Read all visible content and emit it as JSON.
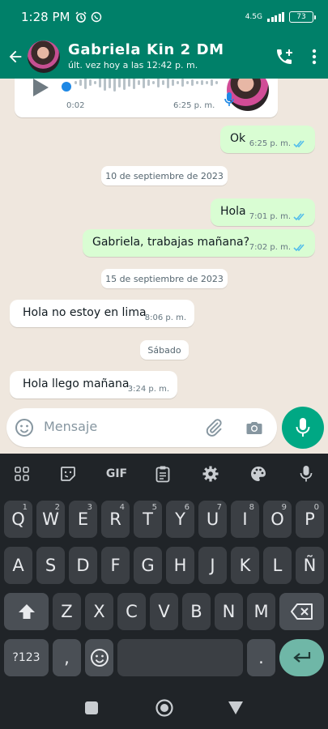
{
  "status_bar": {
    "time": "1:28 PM",
    "network": "4.5G",
    "battery": "73"
  },
  "header": {
    "contact_name": "Gabriela Kin 2 DM",
    "last_seen": "últ. vez hoy a las 12:42 p. m."
  },
  "voice_note": {
    "duration": "0:02",
    "time": "6:25 p. m."
  },
  "messages": [
    {
      "type": "out",
      "text": "Ok",
      "time": "6:25 p. m."
    },
    {
      "type": "date",
      "text": "10 de septiembre de 2023"
    },
    {
      "type": "out",
      "text": "Hola",
      "time": "7:01 p. m."
    },
    {
      "type": "out",
      "text": "Gabriela, trabajas mañana?",
      "time": "7:02 p. m."
    },
    {
      "type": "date",
      "text": "15 de septiembre de 2023"
    },
    {
      "type": "in",
      "text": "Hola no estoy en lima",
      "time": "8:06 p. m."
    },
    {
      "type": "date",
      "text": "Sábado"
    },
    {
      "type": "in",
      "text": "Hola llego mañana",
      "time": "3:24 p. m."
    }
  ],
  "composer": {
    "placeholder": "Mensaje"
  },
  "keyboard": {
    "toolbar_gif": "GIF",
    "row1": [
      "Q",
      "W",
      "E",
      "R",
      "T",
      "Y",
      "U",
      "I",
      "O",
      "P"
    ],
    "row1_hints": [
      "1",
      "2",
      "3",
      "4",
      "5",
      "6",
      "7",
      "8",
      "9",
      "0"
    ],
    "row2": [
      "A",
      "S",
      "D",
      "F",
      "G",
      "H",
      "J",
      "K",
      "L",
      "Ñ"
    ],
    "row3": [
      "Z",
      "X",
      "C",
      "V",
      "B",
      "N",
      "M"
    ],
    "symbols_key": "?123",
    "comma_key": ",",
    "period_key": "."
  },
  "colors": {
    "header": "#008069",
    "outgoing_bubble": "#d9fdd3",
    "accent": "#00a884",
    "read_ticks": "#53bdeb"
  },
  "icons": [
    "back-arrow-icon",
    "add-call-icon",
    "more-vert-icon",
    "play-icon",
    "mic-icon",
    "emoji-icon",
    "attach-icon",
    "camera-icon",
    "read-ticks-icon"
  ]
}
